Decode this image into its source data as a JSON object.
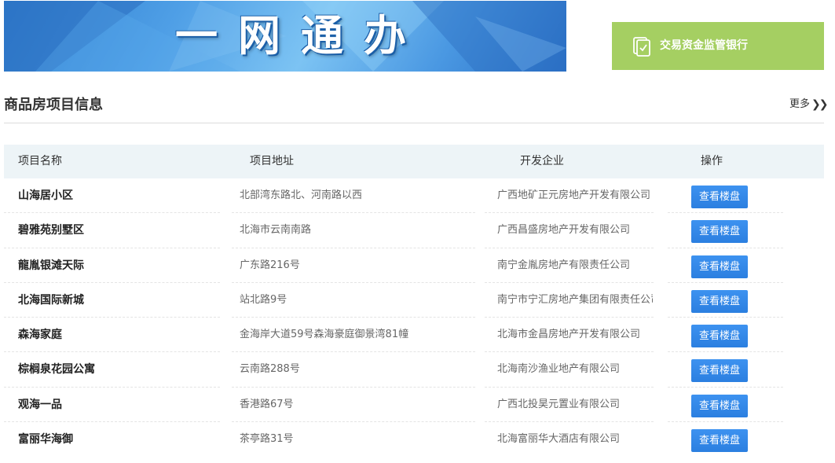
{
  "banner": {
    "title": "一网通办"
  },
  "bank_button": {
    "label": "交易资金监管银行",
    "icon": "document-check-icon"
  },
  "section": {
    "title": "商品房项目信息",
    "more_label": "更多",
    "more_icon": "double-chevron-right-icon"
  },
  "table": {
    "headers": [
      "项目名称",
      "项目地址",
      "开发企业",
      "操作"
    ],
    "action_label": "查看楼盘",
    "rows": [
      {
        "name": "山海居小区",
        "address": "北部湾东路北、河南路以西",
        "developer": "广西地矿正元房地产开发有限公司"
      },
      {
        "name": "碧雅苑别墅区",
        "address": "北海市云南南路",
        "developer": "广西昌盛房地产开发有限公司"
      },
      {
        "name": "龍胤银滩天际",
        "address": "广东路216号",
        "developer": "南宁金胤房地产有限责任公司"
      },
      {
        "name": "北海国际新城",
        "address": "站北路9号",
        "developer": "南宁市宁汇房地产集团有限责任公司"
      },
      {
        "name": "森海家庭",
        "address": "金海岸大道59号森海豪庭御景湾81幢",
        "developer": "北海市金昌房地产开发有限公司"
      },
      {
        "name": "棕榈泉花园公寓",
        "address": "云南路288号",
        "developer": "北海南沙渔业地产有限公司"
      },
      {
        "name": "观海一品",
        "address": "香港路67号",
        "developer": "广西北投昊元置业有限公司"
      },
      {
        "name": "富丽华海御",
        "address": "茶亭路31号",
        "developer": "北海富丽华大酒店有限公司"
      }
    ]
  },
  "colors": {
    "bank_green": "#a5cf62",
    "button_blue": "#2b7fe0",
    "header_bg": "#edf4f7"
  }
}
